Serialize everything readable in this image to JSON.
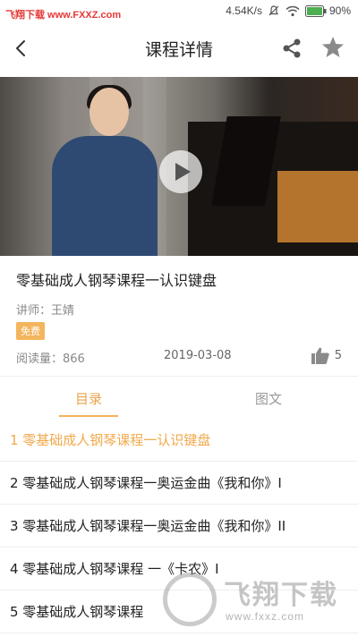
{
  "status_bar": {
    "watermark": "飞翔下载 www.FXXZ.com",
    "network_speed": "4.54K/s",
    "battery": "90%",
    "icons": [
      "bell-off-icon",
      "wifi-icon",
      "battery-icon"
    ]
  },
  "header": {
    "title": "课程详情",
    "icons": [
      "back-icon",
      "share-icon",
      "star-icon"
    ]
  },
  "video": {
    "icon": "play-icon"
  },
  "course": {
    "title": "零基础成人钢琴课程一认识键盘",
    "teacher": "讲师：王婧",
    "badge": "免费",
    "reads": "阅读量：866",
    "date": "2019-03-08",
    "likes": "5"
  },
  "tabs": {
    "items": [
      {
        "label": "目录",
        "active": true
      },
      {
        "label": "图文",
        "active": false
      }
    ]
  },
  "lessons": [
    {
      "label": "1 零基础成人钢琴课程一认识键盘",
      "active": true
    },
    {
      "label": "2 零基础成人钢琴课程一奥运金曲《我和你》I",
      "active": false
    },
    {
      "label": "3 零基础成人钢琴课程一奥运金曲《我和你》II",
      "active": false
    },
    {
      "label": "4 零基础成人钢琴课程 一《卡农》I",
      "active": false
    },
    {
      "label": "5 零基础成人钢琴课程",
      "active": false
    }
  ],
  "watermark_bottom": {
    "brand": "飞翔下载",
    "url": "www.fxxz.com"
  },
  "colors": {
    "accent": "#f1a94c",
    "badge": "#f3b55d",
    "icon_gray": "#555555"
  }
}
